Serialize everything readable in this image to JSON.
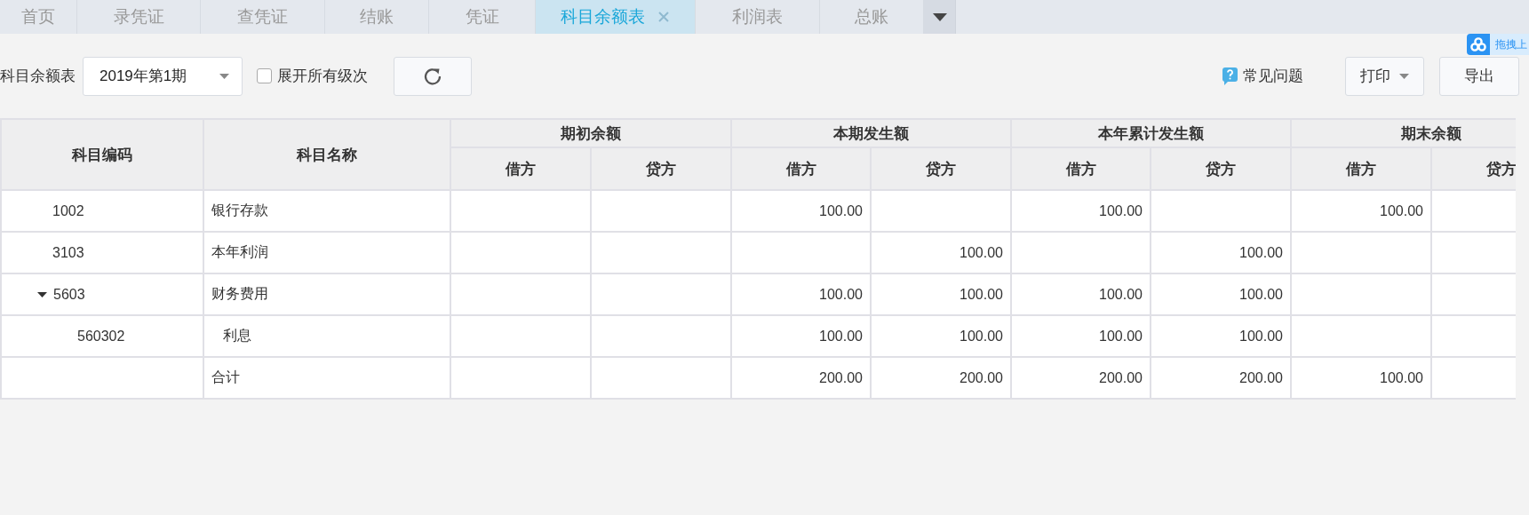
{
  "tabs": [
    {
      "label": "首页",
      "selected": false,
      "closable": false
    },
    {
      "label": "录凭证",
      "selected": false,
      "closable": false
    },
    {
      "label": "查凭证",
      "selected": false,
      "closable": false
    },
    {
      "label": "结账",
      "selected": false,
      "closable": false
    },
    {
      "label": "凭证",
      "selected": false,
      "closable": false
    },
    {
      "label": "科目余额表",
      "selected": true,
      "closable": true
    },
    {
      "label": "利润表",
      "selected": false,
      "closable": false
    },
    {
      "label": "总账",
      "selected": false,
      "closable": false
    }
  ],
  "upload_badge": {
    "label": "拖拽上"
  },
  "toolbar": {
    "title": "科目余额表",
    "period_select": {
      "value": "2019年第1期"
    },
    "expand_all": {
      "label": "展开所有级次",
      "checked": false
    },
    "help_link": {
      "label": "常见问题"
    },
    "print_button": {
      "label": "打印"
    },
    "export_button": {
      "label": "导出"
    }
  },
  "table": {
    "columns": [
      {
        "label": "科目编码"
      },
      {
        "label": "科目名称"
      }
    ],
    "column_groups": [
      {
        "label": "期初余额",
        "columns": [
          "借方",
          "贷方"
        ]
      },
      {
        "label": "本期发生额",
        "columns": [
          "借方",
          "贷方"
        ]
      },
      {
        "label": "本年累计发生额",
        "columns": [
          "借方",
          "贷方"
        ]
      },
      {
        "label": "期末余额",
        "columns": [
          "借方",
          "贷方"
        ]
      }
    ],
    "rows": [
      {
        "code": "1002",
        "name": "银行存款",
        "values": {
          "period_debit": "100.00",
          "ytd_debit": "100.00",
          "closing_debit": "100.00"
        }
      },
      {
        "code": "3103",
        "name": "本年利润",
        "values": {
          "period_credit": "100.00",
          "ytd_credit": "100.00"
        }
      },
      {
        "code": "5603",
        "name": "财务费用",
        "expanded": true,
        "values": {
          "period_debit": "100.00",
          "period_credit": "100.00",
          "ytd_debit": "100.00",
          "ytd_credit": "100.00"
        },
        "children": [
          {
            "code": "560302",
            "name": "利息",
            "values": {
              "period_debit": "100.00",
              "period_credit": "100.00",
              "ytd_debit": "100.00",
              "ytd_credit": "100.00"
            }
          }
        ]
      },
      {
        "name": "合计",
        "values": {
          "period_debit": "200.00",
          "period_credit": "200.00",
          "ytd_debit": "200.00",
          "ytd_credit": "200.00",
          "closing_debit": "100.00"
        }
      }
    ]
  }
}
